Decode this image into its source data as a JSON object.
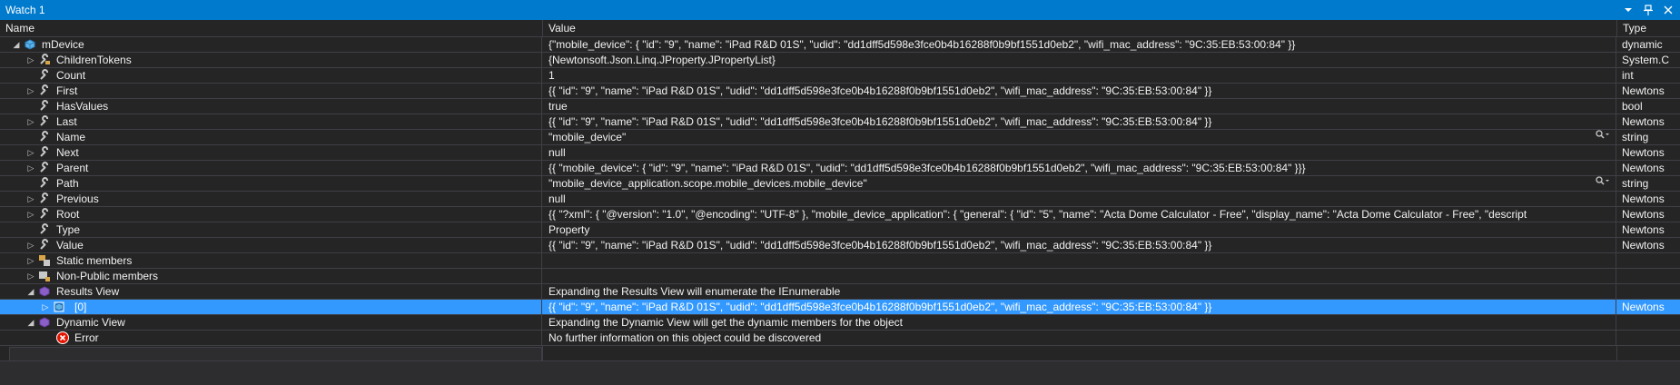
{
  "window": {
    "title": "Watch 1"
  },
  "columns": {
    "name": "Name",
    "value": "Value",
    "type": "Type"
  },
  "rows": [
    {
      "name": "mDevice",
      "value": "{\"mobile_device\": {   \"id\": \"9\",   \"name\": \"iPad R&D 01S\",   \"udid\": \"dd1dff5d598e3fce0b4b16288f0b9bf1551d0eb2\",   \"wifi_mac_address\": \"9C:35:EB:53:00:84\" }}",
      "type": "dynamic"
    },
    {
      "name": "ChildrenTokens",
      "value": "{Newtonsoft.Json.Linq.JProperty.JPropertyList}",
      "type": "System.C"
    },
    {
      "name": "Count",
      "value": "1",
      "type": "int"
    },
    {
      "name": "First",
      "value": "{{   \"id\": \"9\",   \"name\": \"iPad R&D 01S\",   \"udid\": \"dd1dff5d598e3fce0b4b16288f0b9bf1551d0eb2\",   \"wifi_mac_address\": \"9C:35:EB:53:00:84\" }}",
      "type": "Newtons"
    },
    {
      "name": "HasValues",
      "value": "true",
      "type": "bool"
    },
    {
      "name": "Last",
      "value": "{{   \"id\": \"9\",   \"name\": \"iPad R&D 01S\",   \"udid\": \"dd1dff5d598e3fce0b4b16288f0b9bf1551d0eb2\",   \"wifi_mac_address\": \"9C:35:EB:53:00:84\" }}",
      "type": "Newtons"
    },
    {
      "name": "Name",
      "value": "\"mobile_device\"",
      "type": "string"
    },
    {
      "name": "Next",
      "value": "null",
      "type": "Newtons"
    },
    {
      "name": "Parent",
      "value": "{{   \"mobile_device\": {     \"id\": \"9\",     \"name\": \"iPad R&D 01S\",     \"udid\": \"dd1dff5d598e3fce0b4b16288f0b9bf1551d0eb2\",     \"wifi_mac_address\": \"9C:35:EB:53:00:84\"   }}}",
      "type": "Newtons"
    },
    {
      "name": "Path",
      "value": "\"mobile_device_application.scope.mobile_devices.mobile_device\"",
      "type": "string"
    },
    {
      "name": "Previous",
      "value": "null",
      "type": "Newtons"
    },
    {
      "name": "Root",
      "value": "{{   \"?xml\": {     \"@version\": \"1.0\",     \"@encoding\": \"UTF-8\"   },   \"mobile_device_application\": {     \"general\": {       \"id\": \"5\",       \"name\": \"Acta Dome Calculator - Free\",       \"display_name\": \"Acta Dome Calculator - Free\",       \"descript",
      "type": "Newtons"
    },
    {
      "name": "Type",
      "value": "Property",
      "type": "Newtons"
    },
    {
      "name": "Value",
      "value": "{{   \"id\": \"9\",   \"name\": \"iPad R&D 01S\",   \"udid\": \"dd1dff5d598e3fce0b4b16288f0b9bf1551d0eb2\",   \"wifi_mac_address\": \"9C:35:EB:53:00:84\" }}",
      "type": "Newtons"
    },
    {
      "name": "Static members",
      "value": "",
      "type": ""
    },
    {
      "name": "Non-Public members",
      "value": "",
      "type": ""
    },
    {
      "name": "Results View",
      "value": "Expanding the Results View will enumerate the IEnumerable",
      "type": ""
    },
    {
      "name": "[0]",
      "value": "{{   \"id\": \"9\",   \"name\": \"iPad R&D 01S\",   \"udid\": \"dd1dff5d598e3fce0b4b16288f0b9bf1551d0eb2\",   \"wifi_mac_address\": \"9C:35:EB:53:00:84\" }}",
      "type": "Newtons"
    },
    {
      "name": "Dynamic View",
      "value": "Expanding the Dynamic View will get the dynamic members for the object",
      "type": ""
    },
    {
      "name": "Error",
      "value": "No further information on this object could be discovered",
      "type": ""
    }
  ],
  "icons": {
    "dropdown": "chevron-down-icon",
    "pin": "pin-icon",
    "close": "close-icon",
    "search": "magnifier-icon"
  },
  "colors": {
    "accent": "#007acc",
    "selected_row": "#3399ff",
    "background": "#252526",
    "error": "#e51400"
  }
}
